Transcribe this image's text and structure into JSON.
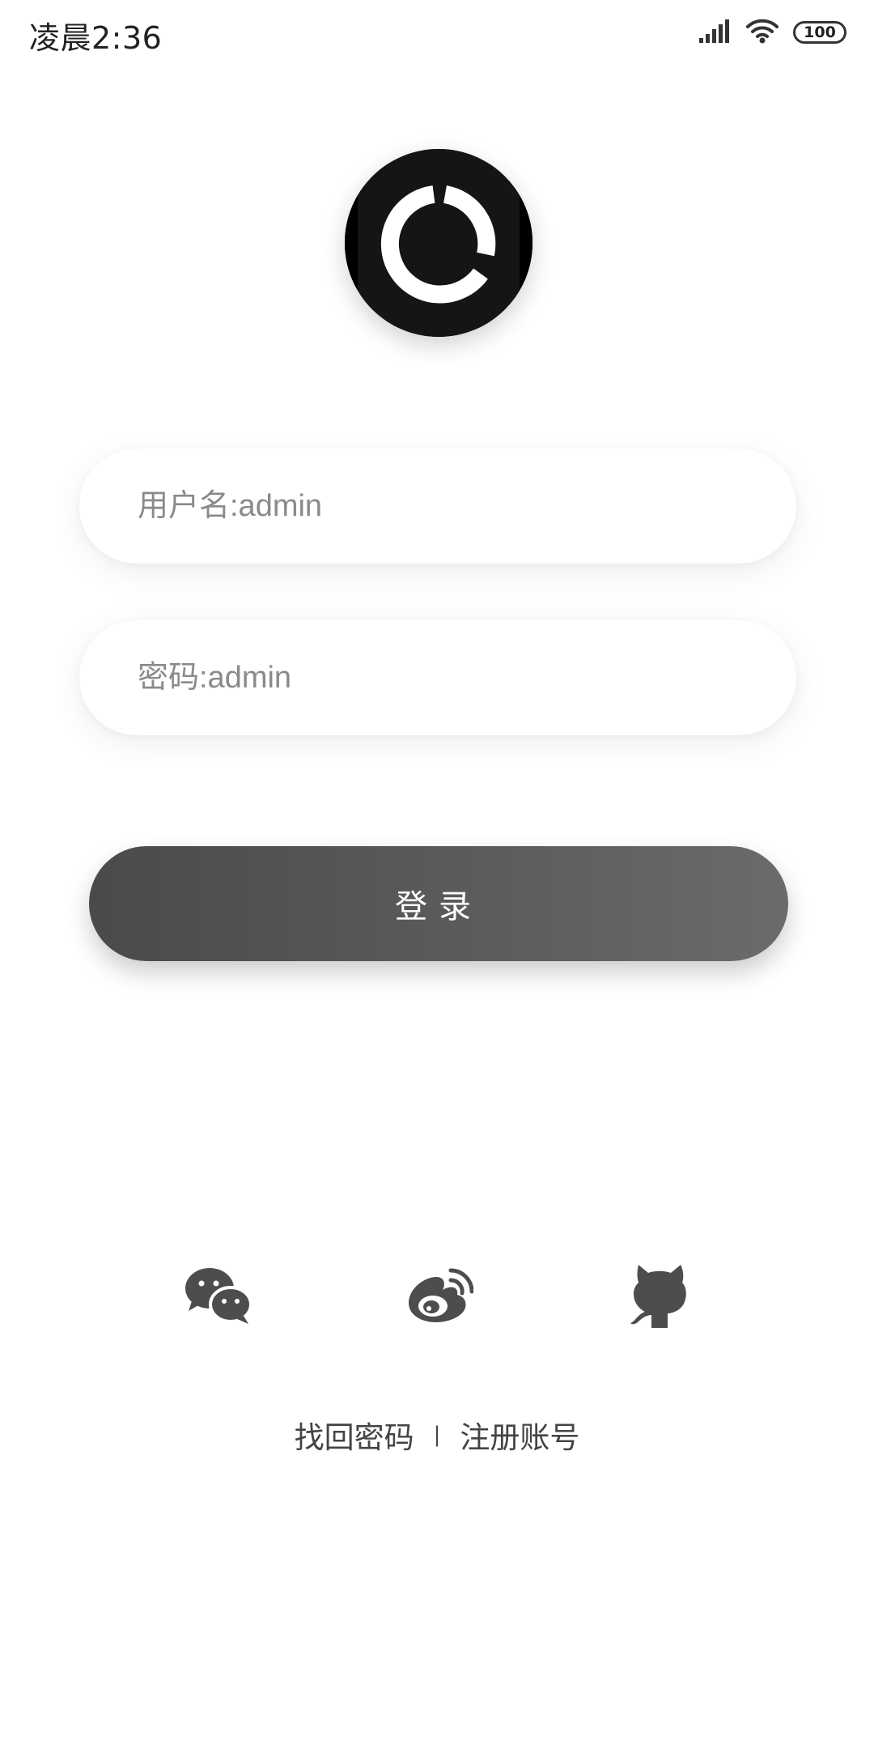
{
  "status_bar": {
    "time": "凌晨2:36",
    "battery": "100",
    "icons": [
      "signal-icon",
      "wifi-icon",
      "battery-icon"
    ]
  },
  "logo": {
    "icon": "app-logo-ring-icon"
  },
  "form": {
    "username_placeholder": "用户名:admin",
    "password_placeholder": "密码:admin",
    "login_label": "登录"
  },
  "social": {
    "icons": [
      "wechat-icon",
      "weibo-icon",
      "github-icon"
    ]
  },
  "links": {
    "forgot_password": "找回密码",
    "separator": "|",
    "register": "注册账号"
  },
  "colors": {
    "button_start": "#4a4a4a",
    "button_end": "#6b6b6b",
    "icon": "#4d4d4d",
    "logo_bg": "#151515"
  }
}
